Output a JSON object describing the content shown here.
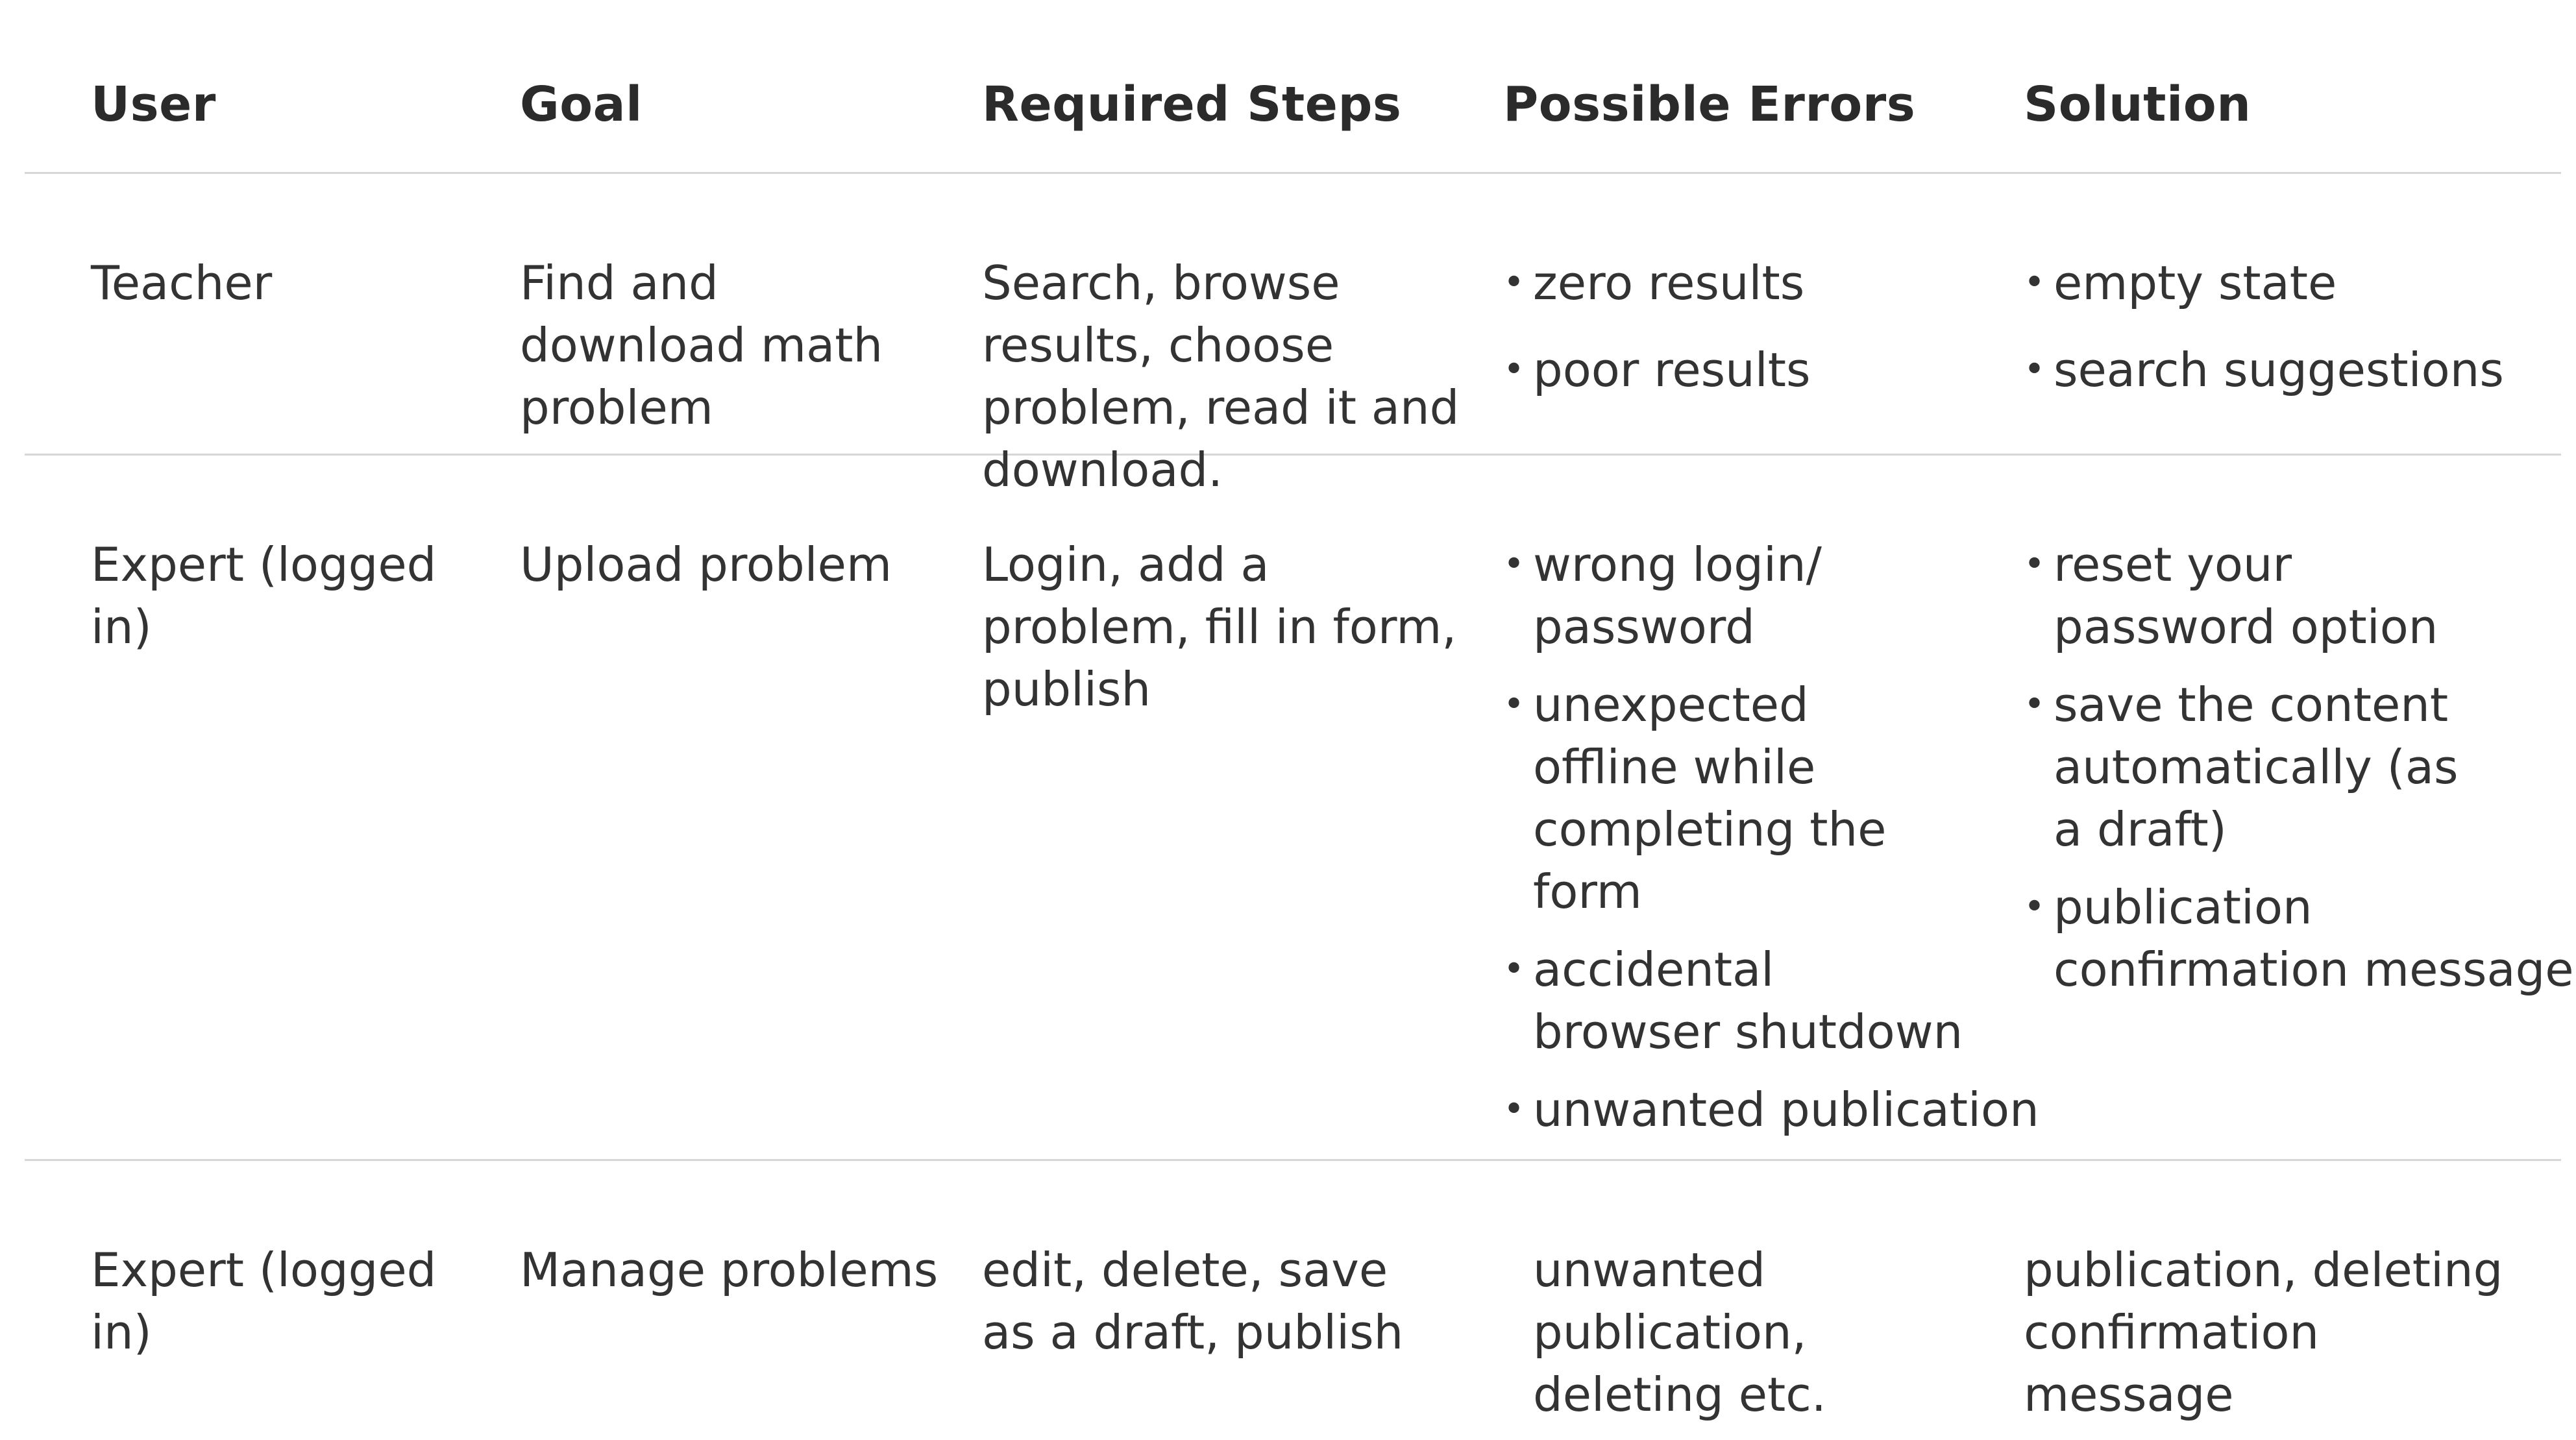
{
  "table": {
    "headers": {
      "user": "User",
      "goal": "Goal",
      "steps": "Required Steps",
      "errors": "Possible Errors",
      "solution": "Solution"
    },
    "rows": [
      {
        "user": "Teacher",
        "goal": "Find and download math problem",
        "steps": "Search, browse results, choose problem, read it and download.",
        "errors": [
          "zero results",
          "poor results"
        ],
        "solutions": [
          "empty state",
          "search suggestions"
        ]
      },
      {
        "user": "Expert (logged in)",
        "goal": "Upload problem",
        "steps": "Login, add a problem, fill in form, publish",
        "errors": [
          "wrong login/ password",
          "unexpected offline while completing the form",
          "accidental browser shutdown",
          "unwanted publication"
        ],
        "solutions": [
          "reset your password option",
          "save the content automatically (as a draft)",
          "publication confirmation message"
        ]
      },
      {
        "user": "Expert (logged in)",
        "goal": "Manage problems",
        "steps": "edit, delete, save as a draft, publish",
        "errors_text": "unwanted publication, deleting etc.",
        "solution_text": "publication, deleting confirmation message"
      }
    ],
    "bullet": "•"
  }
}
